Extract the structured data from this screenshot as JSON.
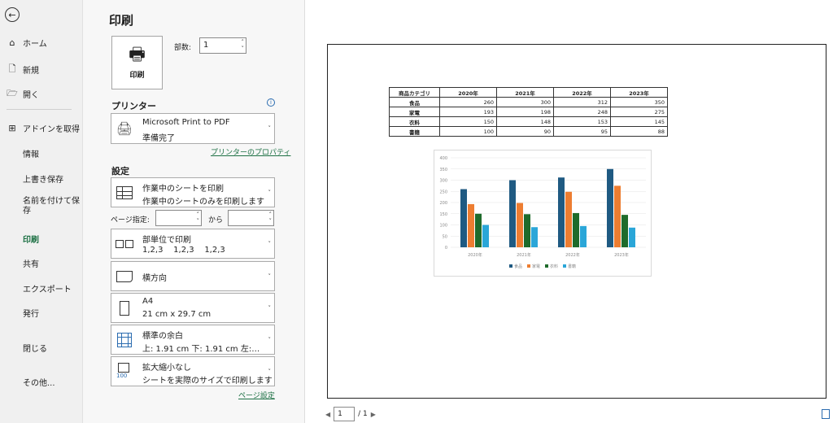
{
  "nav": {
    "items": [
      {
        "icon": "home-icon",
        "label": "ホーム"
      },
      {
        "icon": "new-document-icon",
        "label": "新規"
      },
      {
        "icon": "open-folder-icon",
        "label": "開く"
      },
      {
        "icon": "add-ins-icon",
        "label": "アドインを取得"
      },
      {
        "label": "情報"
      },
      {
        "label": "上書き保存"
      },
      {
        "label": "名前を付けて保存"
      },
      {
        "label": "印刷",
        "active": true
      },
      {
        "label": "共有"
      },
      {
        "label": "エクスポート"
      },
      {
        "label": "発行"
      },
      {
        "label": "閉じる"
      },
      {
        "label": "その他..."
      }
    ]
  },
  "print": {
    "title": "印刷",
    "button_label": "印刷",
    "copies_label": "部数:",
    "copies_value": "1"
  },
  "printer": {
    "section_label": "プリンター",
    "name": "Microsoft Print to PDF",
    "status": "準備完了",
    "properties_link": "プリンターのプロパティ"
  },
  "settings": {
    "section_label": "設定",
    "scope": {
      "line1": "作業中のシートを印刷",
      "line2": "作業中のシートのみを印刷します"
    },
    "pages_label": "ページ指定:",
    "pages_to": "から",
    "collate": {
      "line1": "部単位で印刷",
      "line2": "1,2,3    1,2,3    1,2,3"
    },
    "orientation": {
      "line1": "横方向"
    },
    "paper": {
      "line1": "A4",
      "line2": "21 cm x 29.7 cm"
    },
    "margins": {
      "line1": "標準の余白",
      "line2": "上: 1.91 cm 下: 1.91 cm 左:…"
    },
    "scaling": {
      "line1": "拡大縮小なし",
      "line2": "シートを実際のサイズで印刷します"
    },
    "page_setup_link": "ページ設定"
  },
  "preview": {
    "table": {
      "headers": [
        "商品カテゴリ",
        "2020年",
        "2021年",
        "2022年",
        "2023年"
      ],
      "rows": [
        [
          "食品",
          "260",
          "300",
          "312",
          "350"
        ],
        [
          "家電",
          "193",
          "198",
          "248",
          "275"
        ],
        [
          "衣料",
          "150",
          "148",
          "153",
          "145"
        ],
        [
          "書籍",
          "100",
          "90",
          "95",
          "88"
        ]
      ]
    },
    "pager": {
      "current": "1",
      "total": "/ 1"
    }
  },
  "chart_data": {
    "type": "bar",
    "categories": [
      "2020年",
      "2021年",
      "2022年",
      "2023年"
    ],
    "series": [
      {
        "name": "食品",
        "values": [
          260,
          300,
          312,
          350
        ],
        "color": "#1f5a82"
      },
      {
        "name": "家電",
        "values": [
          193,
          198,
          248,
          275
        ],
        "color": "#ed7d31"
      },
      {
        "name": "衣料",
        "values": [
          150,
          148,
          153,
          145
        ],
        "color": "#1e6b2b"
      },
      {
        "name": "書籍",
        "values": [
          100,
          90,
          95,
          88
        ],
        "color": "#2aa6d8"
      }
    ],
    "yticks": [
      "0",
      "50",
      "100",
      "150",
      "200",
      "250",
      "300",
      "350",
      "400"
    ],
    "ylim": [
      0,
      400
    ],
    "grid": true,
    "legend": "bottom"
  },
  "colors": {
    "accent": "#1e7145"
  }
}
